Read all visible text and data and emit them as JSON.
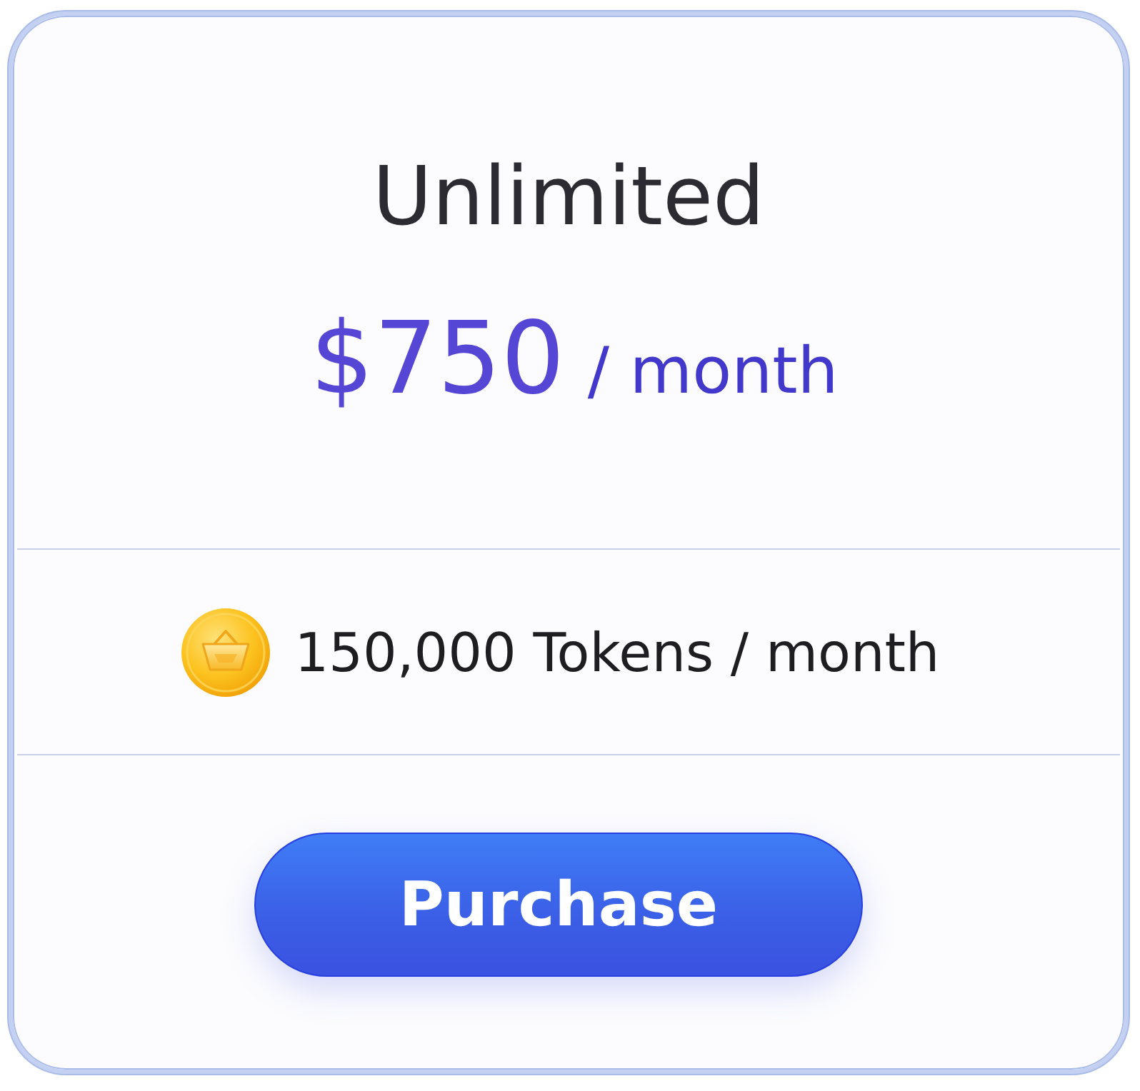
{
  "plan": {
    "name": "Unlimited",
    "price": "$750",
    "period": "/ month"
  },
  "tokens": {
    "amount": "150,000 Tokens / month"
  },
  "button": {
    "label": "Purchase"
  }
}
